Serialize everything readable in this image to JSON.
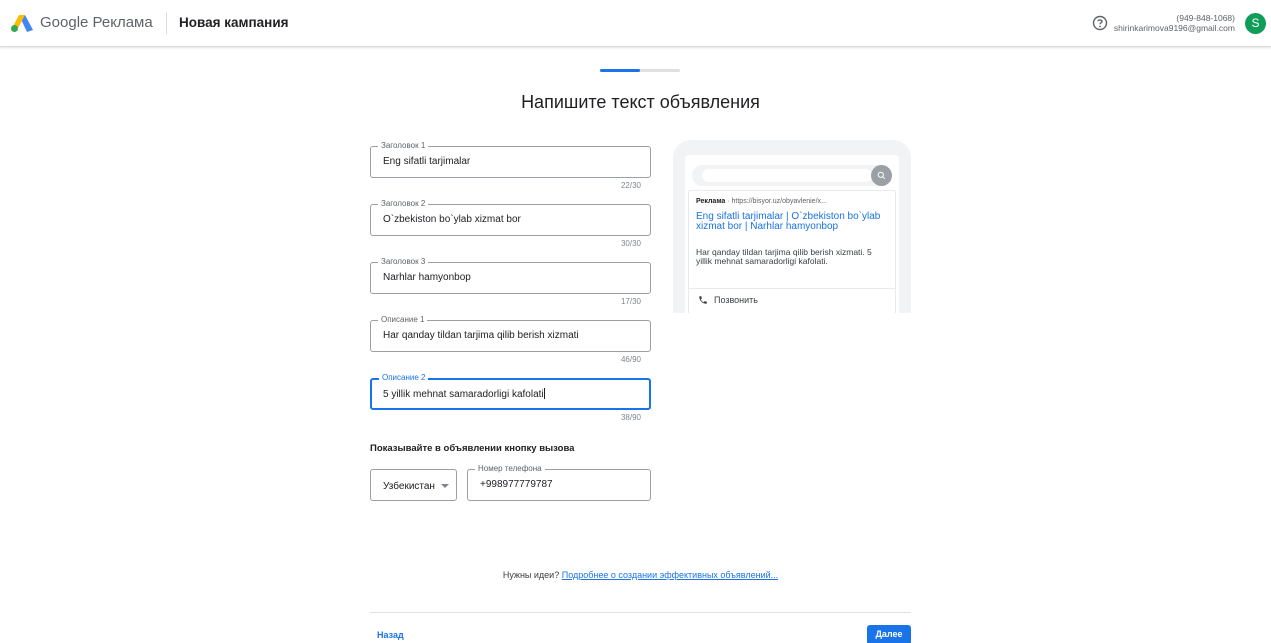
{
  "header": {
    "brand_google": "Google",
    "brand_product": "Реклама",
    "campaign_title": "Новая кампания",
    "account_phone": "(949-848-1068)",
    "account_email": "shirinkarimova9196@gmail.com",
    "avatar_letter": "S"
  },
  "progress": {
    "fraction": 0.5
  },
  "page_title": "Напишите текст объявления",
  "fields": [
    {
      "label": "Заголовок 1",
      "value": "Eng sifatli tarjimalar",
      "counter": "22/30"
    },
    {
      "label": "Заголовок 2",
      "value": "O`zbekiston bo`ylab xizmat bor",
      "counter": "30/30"
    },
    {
      "label": "Заголовок 3",
      "value": "Narhlar hamyonbop",
      "counter": "17/30"
    },
    {
      "label": "Описание 1",
      "value": "Har qanday tildan tarjima qilib berish xizmati",
      "counter": "46/90"
    },
    {
      "label": "Описание 2",
      "value": "5 yillik mehnat samaradorligi kafolati",
      "counter": "38/90"
    }
  ],
  "call": {
    "title": "Показывайте в объявлении кнопку вызова",
    "country": "Узбекистан",
    "phone_label": "Номер телефона",
    "phone_value": "+998977779787"
  },
  "preview": {
    "ad_badge": "Реклама",
    "url": " · https://bisyor.uz/obyavlenie/x...",
    "headline": "Eng sifatli tarjimalar | O`zbekiston bo`ylab xizmat bor | Narhlar hamyonbop",
    "description": "Har qanday tildan tarjima qilib berish xizmati. 5 yillik mehnat samaradorligi kafolati.",
    "call_label": "Позвонить"
  },
  "ideas": {
    "text": "Нужны идеи? ",
    "link": "Подробнее о создании эффективных объявлений..."
  },
  "footer": {
    "back": "Назад",
    "next": "Далее"
  },
  "colors": {
    "accent": "#1a73e8",
    "avatar": "#0f9d58"
  }
}
